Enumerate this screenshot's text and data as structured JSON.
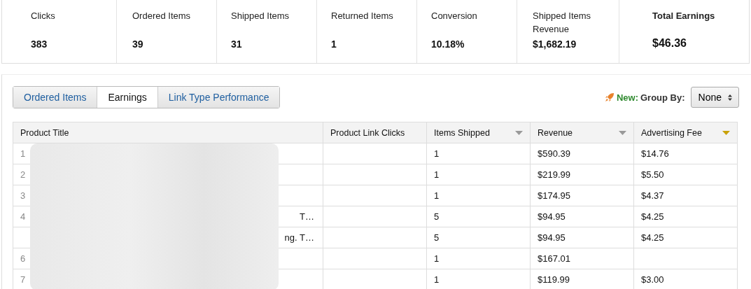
{
  "summary": [
    {
      "label": "Clicks",
      "value": "383",
      "emphasis": false
    },
    {
      "label": "Ordered Items",
      "value": "39",
      "emphasis": false
    },
    {
      "label": "Shipped Items",
      "value": "31",
      "emphasis": false
    },
    {
      "label": "Returned Items",
      "value": "1",
      "emphasis": false
    },
    {
      "label": "Conversion",
      "value": "10.18%",
      "emphasis": false
    },
    {
      "label": "Shipped Items Revenue",
      "value": "$1,682.19",
      "emphasis": false
    },
    {
      "label": "Total Earnings",
      "value": "$46.36",
      "emphasis": true
    }
  ],
  "tabs": [
    {
      "label": "Ordered Items",
      "selected": false
    },
    {
      "label": "Earnings",
      "selected": true
    },
    {
      "label": "Link Type Performance",
      "selected": false
    }
  ],
  "group_by": {
    "badge": "New:",
    "label": "Group By:",
    "value": "None"
  },
  "table": {
    "columns": [
      {
        "label": "Product Title"
      },
      {
        "label": "Product Link Clicks"
      },
      {
        "label": "Items Shipped",
        "sorted": false
      },
      {
        "label": "Revenue",
        "sorted": false
      },
      {
        "label": "Advertising Fee",
        "sorted": true
      }
    ],
    "rows": [
      {
        "number": "1",
        "cells": [
          "",
          "",
          "1",
          "$590.39",
          "$14.76"
        ]
      },
      {
        "number": "2",
        "cells": [
          "",
          "",
          "1",
          "$219.99",
          "$5.50"
        ]
      },
      {
        "number": "3",
        "cells": [
          "",
          "",
          "1",
          "$174.95",
          "$4.37"
        ]
      },
      {
        "number": "4",
        "cells": [
          "T…",
          "",
          "5",
          "$94.95",
          "$4.25"
        ]
      },
      {
        "cells": [
          "ng. T…",
          "",
          "5",
          "$94.95",
          "$4.25"
        ]
      },
      {
        "number": "6",
        "cells": [
          "",
          "",
          "1",
          "$167.01",
          ""
        ]
      },
      {
        "number": "7",
        "cells": [
          "",
          "",
          "1",
          "$119.99",
          "$3.00"
        ]
      }
    ]
  }
}
